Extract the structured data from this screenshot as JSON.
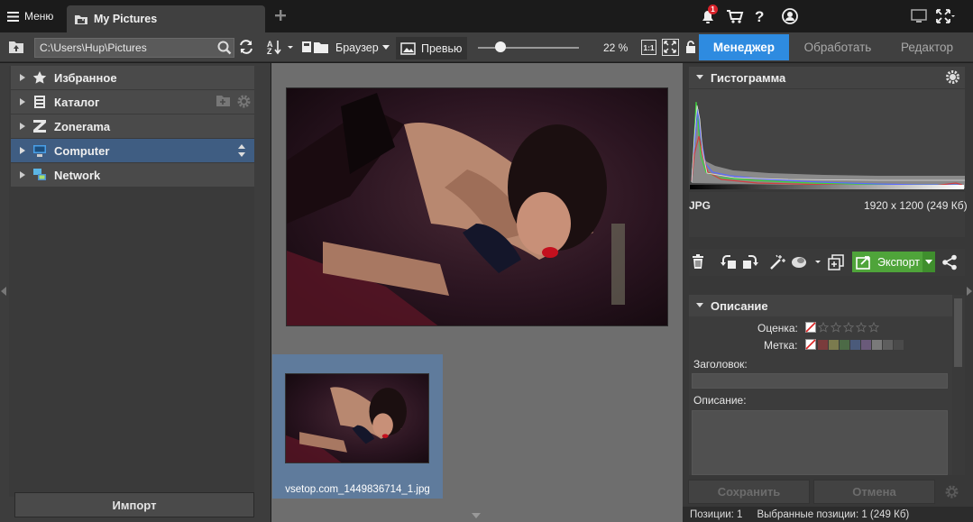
{
  "titlebar": {
    "menu_label": "Меню",
    "tab_title": "My Pictures",
    "notification_count": "1"
  },
  "toolbar": {
    "path": "C:\\Users\\Hup\\Pictures",
    "browser_label": "Браузер",
    "preview_label": "Превью",
    "zoom_percent": "22 %",
    "zoom_fraction": 0.22,
    "actual_size_label": "1:1"
  },
  "modes": {
    "manager": "Менеджер",
    "develop": "Обработать",
    "editor": "Редактор"
  },
  "navigator": {
    "items": [
      {
        "label": "Избранное",
        "icon": "star-icon"
      },
      {
        "label": "Каталог",
        "icon": "catalog-icon"
      },
      {
        "label": "Zonerama",
        "icon": "zonerama-icon"
      },
      {
        "label": "Computer",
        "icon": "computer-icon"
      },
      {
        "label": "Network",
        "icon": "network-icon"
      }
    ],
    "import_label": "Импорт"
  },
  "browser": {
    "thumbnail_name": "vsetop.com_1449836714_1.jpg"
  },
  "histogram": {
    "title": "Гистограмма",
    "format": "JPG",
    "dimensions": "1920 x 1200 (249 Кб)"
  },
  "actions": {
    "export_label": "Экспорт"
  },
  "description_panel": {
    "title": "Описание",
    "rating_label": "Оценка:",
    "label_label": "Метка:",
    "heading_label": "Заголовок:",
    "description_label": "Описание:",
    "label_colors": [
      "#7a3c3c",
      "#7b7b4e",
      "#4c6a46",
      "#4a5a7a",
      "#6a5a7a",
      "#7a7a7a",
      "#5e5e5e",
      "#4a4a4a"
    ]
  },
  "buttons": {
    "save": "Сохранить",
    "cancel": "Отмена"
  },
  "status": {
    "positions": "Позиции: 1",
    "selected": "Выбранные позиции: 1 (249 Кб)"
  },
  "colors": {
    "accent": "#2e8be0",
    "export_green": "#4fa43a",
    "notification_red": "#d9232b"
  }
}
